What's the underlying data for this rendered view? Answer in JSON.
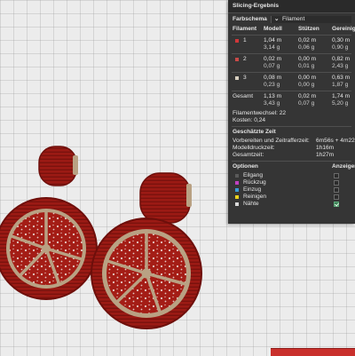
{
  "panel": {
    "title": "Slicing-Ergebnis",
    "color_scheme_label": "Farbschema",
    "color_scheme_value": "Filament",
    "columns": [
      "Filament",
      "Modell",
      "Stützen",
      "Gereinigt"
    ],
    "filaments": [
      {
        "id": "1",
        "color": "#d0373a",
        "model": [
          "1,04 m",
          "3,14 g"
        ],
        "support": [
          "0,02 m",
          "0,06 g"
        ],
        "flushed": [
          "0,30 m",
          "0,90 g"
        ]
      },
      {
        "id": "2",
        "color": "#c94a48",
        "model": [
          "0,02 m",
          "0,07 g"
        ],
        "support": [
          "0,00 m",
          "0,01 g"
        ],
        "flushed": [
          "0,82 m",
          "2,43 g"
        ]
      },
      {
        "id": "3",
        "color": "#d8cfbf",
        "model": [
          "0,08 m",
          "0,23 g"
        ],
        "support": [
          "0,00 m",
          "0,00 g"
        ],
        "flushed": [
          "0,63 m",
          "1,87 g"
        ]
      }
    ],
    "total": {
      "label": "Gesamt",
      "model": [
        "1,13 m",
        "3,43 g"
      ],
      "support": [
        "0,02 m",
        "0,07 g"
      ],
      "flushed": [
        "1,74 m",
        "5,20 g"
      ]
    },
    "filament_changes": "Filamentwechsel:   22",
    "cost": "Kosten:   0,24",
    "estimated_time_title": "Geschätzte Zeit",
    "time_rows": [
      {
        "label": "Vorbereiten und Zeitraffer­zeit:",
        "value": "6m56s + 4m22s"
      },
      {
        "label": "Modelldruckzeit:",
        "value": "1h16m"
      },
      {
        "label": "Gesamtzeit:",
        "value": "1h27m"
      }
    ],
    "options_label": "Optionen",
    "display_label": "Anzeigen",
    "options": [
      {
        "label": "Eilgang",
        "color": "#5a5a5a",
        "checked": false
      },
      {
        "label": "Rückzug",
        "color": "#c041c0",
        "checked": false
      },
      {
        "label": "Einzug",
        "color": "#3a9bd6",
        "checked": false
      },
      {
        "label": "Reinigen",
        "color": "#e9d21d",
        "checked": false
      },
      {
        "label": "Nähte",
        "color": "#d9d9d9",
        "checked": true
      }
    ]
  },
  "colors": {
    "model_red": "#9b1a14",
    "model_red_dark": "#6e0f0b",
    "model_beige": "#b9a183",
    "accent_red": "#c9302c"
  }
}
